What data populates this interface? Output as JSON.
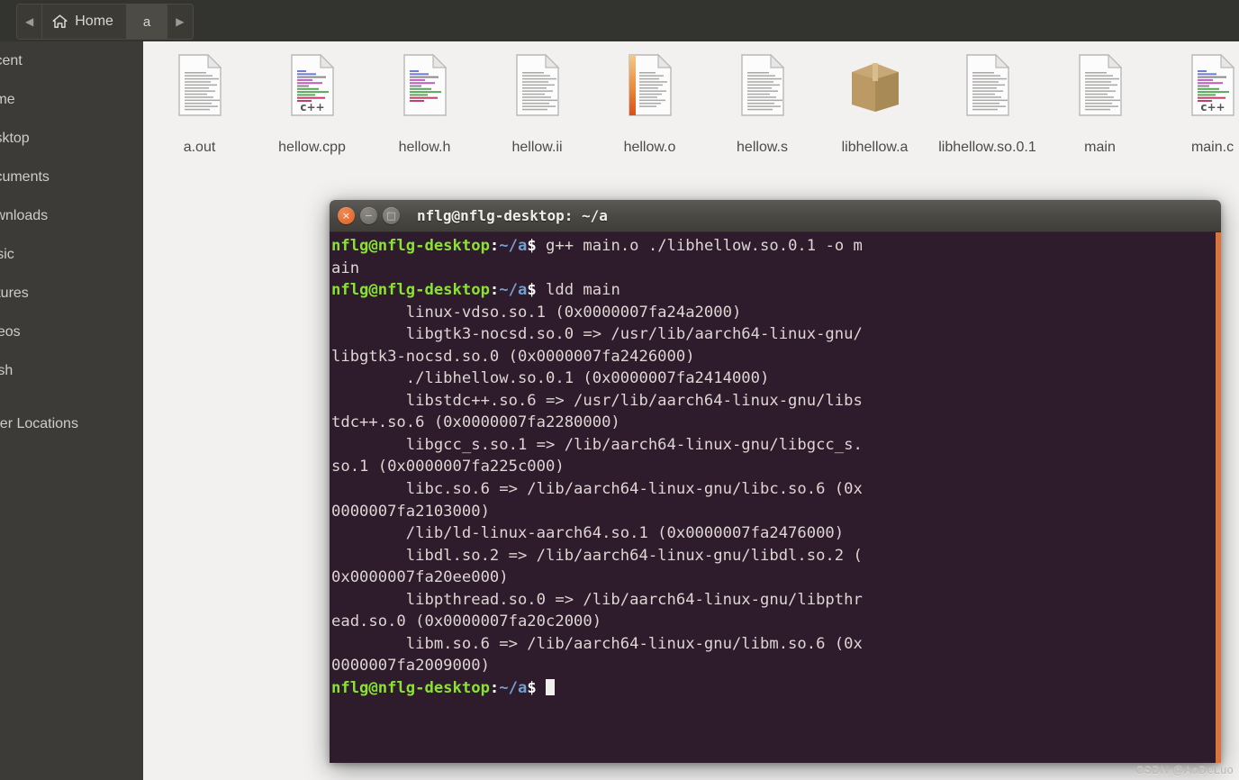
{
  "window": {
    "file_manager_title": "Home"
  },
  "breadcrumb": {
    "back_icon": "◀",
    "forward_icon": "▶",
    "home_label": "Home",
    "home_icon": "home-icon",
    "current_label": "a"
  },
  "sidebar": {
    "items": [
      {
        "label": "Recent",
        "icon": "clock-icon"
      },
      {
        "label": "Home",
        "icon": "home-icon"
      },
      {
        "label": "Desktop",
        "icon": "desktop-icon"
      },
      {
        "label": "Documents",
        "icon": "documents-icon"
      },
      {
        "label": "Downloads",
        "icon": "downloads-icon"
      },
      {
        "label": "Music",
        "icon": "music-icon"
      },
      {
        "label": "Pictures",
        "icon": "pictures-icon"
      },
      {
        "label": "Videos",
        "icon": "videos-icon"
      },
      {
        "label": "Trash",
        "icon": "trash-icon"
      }
    ],
    "other_locations": {
      "label": "Other Locations",
      "icon": "network-icon"
    }
  },
  "files": [
    {
      "name": "a.out",
      "icon": "text-document-icon"
    },
    {
      "name": "hellow.cpp",
      "icon": "cpp-source-icon"
    },
    {
      "name": "hellow.h",
      "icon": "c-header-icon"
    },
    {
      "name": "hellow.ii",
      "icon": "text-document-icon"
    },
    {
      "name": "hellow.o",
      "icon": "object-file-icon"
    },
    {
      "name": "hellow.s",
      "icon": "text-document-icon"
    },
    {
      "name": "libhellow.a",
      "icon": "archive-package-icon"
    },
    {
      "name": "libhellow.so.0.1",
      "icon": "text-document-icon"
    },
    {
      "name": "main",
      "icon": "text-document-icon"
    },
    {
      "name": "main.c",
      "icon": "cpp-source-icon"
    }
  ],
  "terminal": {
    "title": "nflg@nflg-desktop: ~/a",
    "buttons": {
      "close": "×",
      "minimize": "−",
      "maximize": "□"
    },
    "prompt": {
      "user_host": "nflg@nflg-desktop",
      "separator": ":",
      "path": "~/a",
      "sigil": "$"
    },
    "lines": [
      {
        "type": "prompt",
        "command": "g++ main.o ./libhellow.so.0.1 -o main"
      },
      {
        "type": "prompt",
        "command": "ldd main"
      },
      {
        "type": "output",
        "text": "\tlinux-vdso.so.1 (0x0000007fa24a2000)"
      },
      {
        "type": "output",
        "text": "\tlibgtk3-nocsd.so.0 => /usr/lib/aarch64-linux-gnu/libgtk3-nocsd.so.0 (0x0000007fa2426000)"
      },
      {
        "type": "output",
        "text": "\t./libhellow.so.0.1 (0x0000007fa2414000)"
      },
      {
        "type": "output",
        "text": "\tlibstdc++.so.6 => /usr/lib/aarch64-linux-gnu/libstdc++.so.6 (0x0000007fa2280000)"
      },
      {
        "type": "output",
        "text": "\tlibgcc_s.so.1 => /lib/aarch64-linux-gnu/libgcc_s.so.1 (0x0000007fa225c000)"
      },
      {
        "type": "output",
        "text": "\tlibc.so.6 => /lib/aarch64-linux-gnu/libc.so.6 (0x0000007fa2103000)"
      },
      {
        "type": "output",
        "text": "\t/lib/ld-linux-aarch64.so.1 (0x0000007fa2476000)"
      },
      {
        "type": "output",
        "text": "\tlibdl.so.2 => /lib/aarch64-linux-gnu/libdl.so.2 (0x0000007fa20ee000)"
      },
      {
        "type": "output",
        "text": "\tlibpthread.so.0 => /lib/aarch64-linux-gnu/libpthread.so.0 (0x0000007fa20c2000)"
      },
      {
        "type": "output",
        "text": "\tlibm.so.6 => /lib/aarch64-linux-gnu/libm.so.6 (0x0000007fa2009000)"
      },
      {
        "type": "prompt",
        "command": ""
      }
    ]
  },
  "colors": {
    "terminal_bg": "#2e1b2b",
    "prompt_green": "#8ae234",
    "prompt_blue": "#729fcf",
    "scrollbar": "#d9743f",
    "close_button": "#dd5f28",
    "sidebar_bg": "#3c3b37",
    "file_area_bg": "#f2f1f0"
  },
  "watermark": {
    "text": "CSDN @AoDeLuo"
  }
}
